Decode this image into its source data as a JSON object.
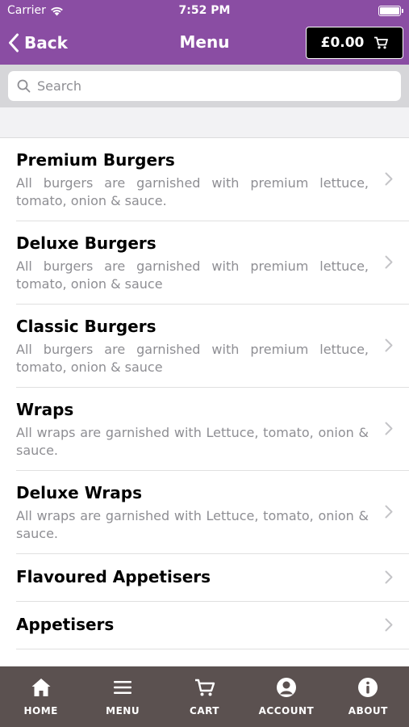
{
  "status_bar": {
    "carrier": "Carrier",
    "time": "7:52 PM"
  },
  "nav": {
    "back_label": "Back",
    "title": "Menu",
    "cart_total": "£0.00"
  },
  "search": {
    "placeholder": "Search",
    "value": ""
  },
  "menu_items": [
    {
      "title": "Premium Burgers",
      "description": "All burgers are garnished with premium lettuce, tomato, onion & sauce."
    },
    {
      "title": "Deluxe Burgers",
      "description": "All burgers are garnished with premium lettuce, tomato, onion & sauce"
    },
    {
      "title": "Classic Burgers",
      "description": "All burgers are garnished with premium lettuce, tomato, onion & sauce"
    },
    {
      "title": "Wraps",
      "description": "All wraps are garnished with Lettuce, tomato, onion & sauce."
    },
    {
      "title": "Deluxe Wraps",
      "description": "All wraps are garnished with Lettuce, tomato, onion & sauce."
    },
    {
      "title": "Flavoured Appetisers",
      "description": ""
    },
    {
      "title": "Appetisers",
      "description": ""
    }
  ],
  "tabs": [
    {
      "label": "HOME",
      "icon": "home-icon"
    },
    {
      "label": "MENU",
      "icon": "menu-icon"
    },
    {
      "label": "CART",
      "icon": "cart-icon"
    },
    {
      "label": "ACCOUNT",
      "icon": "account-icon"
    },
    {
      "label": "ABOUT",
      "icon": "info-icon"
    }
  ],
  "colors": {
    "header": "#8a4da3",
    "tab_bar": "#5b5150",
    "cart_button": "#000000"
  }
}
